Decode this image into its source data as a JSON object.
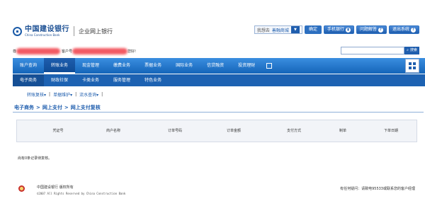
{
  "header": {
    "logo_cn": "中国建设银行",
    "logo_en": "China Construction Bank",
    "subtitle": "企业网上银行",
    "search_label": "我想去",
    "search_value": "善融商城",
    "confirm": "确定",
    "buttons": [
      {
        "label": "手机银行",
        "icon": "phone-icon"
      },
      {
        "label": "问题解答",
        "icon": "question-icon"
      },
      {
        "label": "退出系统",
        "icon": "help-icon"
      }
    ]
  },
  "infobar": {
    "prefix": "尊",
    "customer": "客户号",
    "greeting": "您好!",
    "search_btn": "搜索"
  },
  "nav": {
    "main": [
      "账户查询",
      "转账业务",
      "现金管理",
      "缴费业务",
      "票据业务",
      "国际业务",
      "信贷融资",
      "投资理财"
    ],
    "active_main": "转账业务",
    "sub": [
      "电子商务",
      "财政社保",
      "卡类业务",
      "服务管理",
      "特色业务"
    ],
    "active_sub": "电子商务",
    "third": [
      "转账复核",
      "单据维护",
      "流水查询"
    ]
  },
  "breadcrumb": [
    "电子商务",
    "网上支付",
    "网上支付复核"
  ],
  "table": {
    "columns": [
      "凭证号",
      "商户名称",
      "订单号码",
      "订单金额",
      "支付方式",
      "制单",
      "下单日期"
    ]
  },
  "empty_message": "尚有0条记录待复核。",
  "footer": {
    "org": "中国建设银行  版权所有",
    "copyright": "©2007 All Rights Reserved by China Construction Bank",
    "contact": "有任何疑问：请致电95533或联系您的客户经理"
  }
}
